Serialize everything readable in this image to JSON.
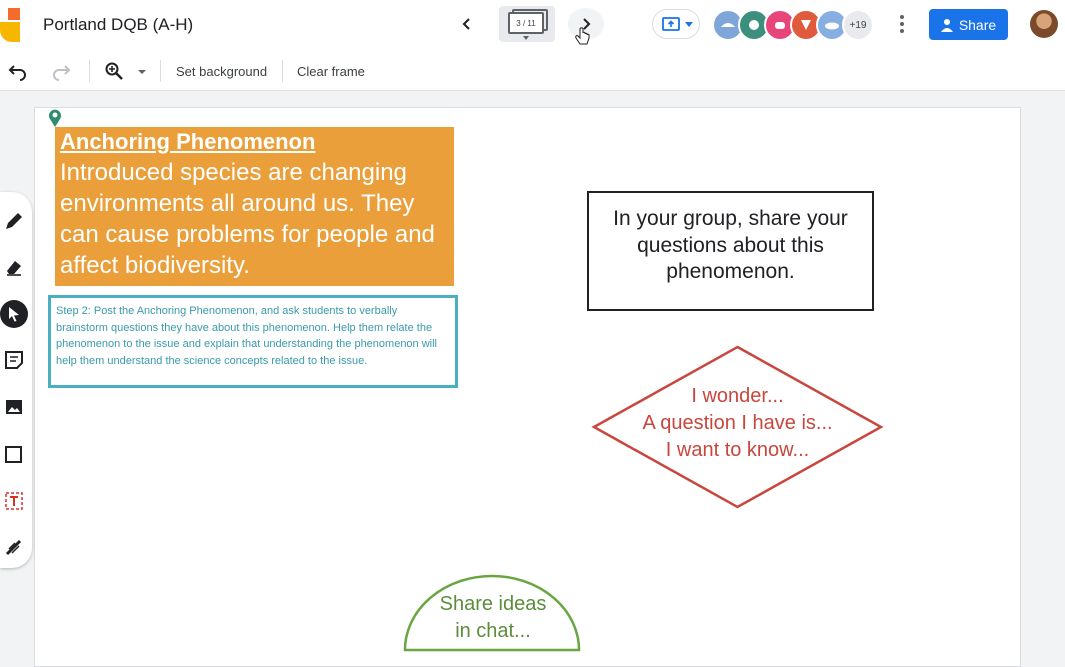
{
  "header": {
    "doc_title": "Portland DQB (A-H)",
    "frame_counter": "3 / 11",
    "avatars_more": "+19",
    "share_label": "Share",
    "colors": {
      "share": "#1a73e8",
      "avatars": [
        "#7ea6d8",
        "#3b8f7c",
        "#e8457b",
        "#e05a3c",
        "#86aee0"
      ]
    }
  },
  "toolbar": {
    "set_background": "Set background",
    "clear_frame": "Clear frame"
  },
  "side_tools": [
    "pen-icon",
    "eraser-icon",
    "select-icon",
    "sticky-note-icon",
    "image-icon",
    "shape-icon",
    "text-box-icon",
    "laser-icon"
  ],
  "canvas": {
    "anchoring": {
      "heading": "Anchoring Phenomenon",
      "body": "Introduced species are changing environments all around us. They can cause problems for people and affect biodiversity.",
      "color": "#ea9f3b"
    },
    "step_note": "Step 2: Post the Anchoring Phenomenon, and ask students to verbally brainstorm questions they have about this phenomenon. Help them relate the phenomenon to the issue and explain that understanding the phenomenon will help them understand the science concepts related to the issue.",
    "group_prompt": "In your group, share your questions about this phenomenon.",
    "wonder": {
      "line1": "I wonder...",
      "line2": "A question I have is...",
      "line3": "I want to know...",
      "color": "#c9463d"
    },
    "share_ideas": {
      "line1": "Share ideas",
      "line2": "in chat...",
      "color": "#6aa543"
    }
  }
}
